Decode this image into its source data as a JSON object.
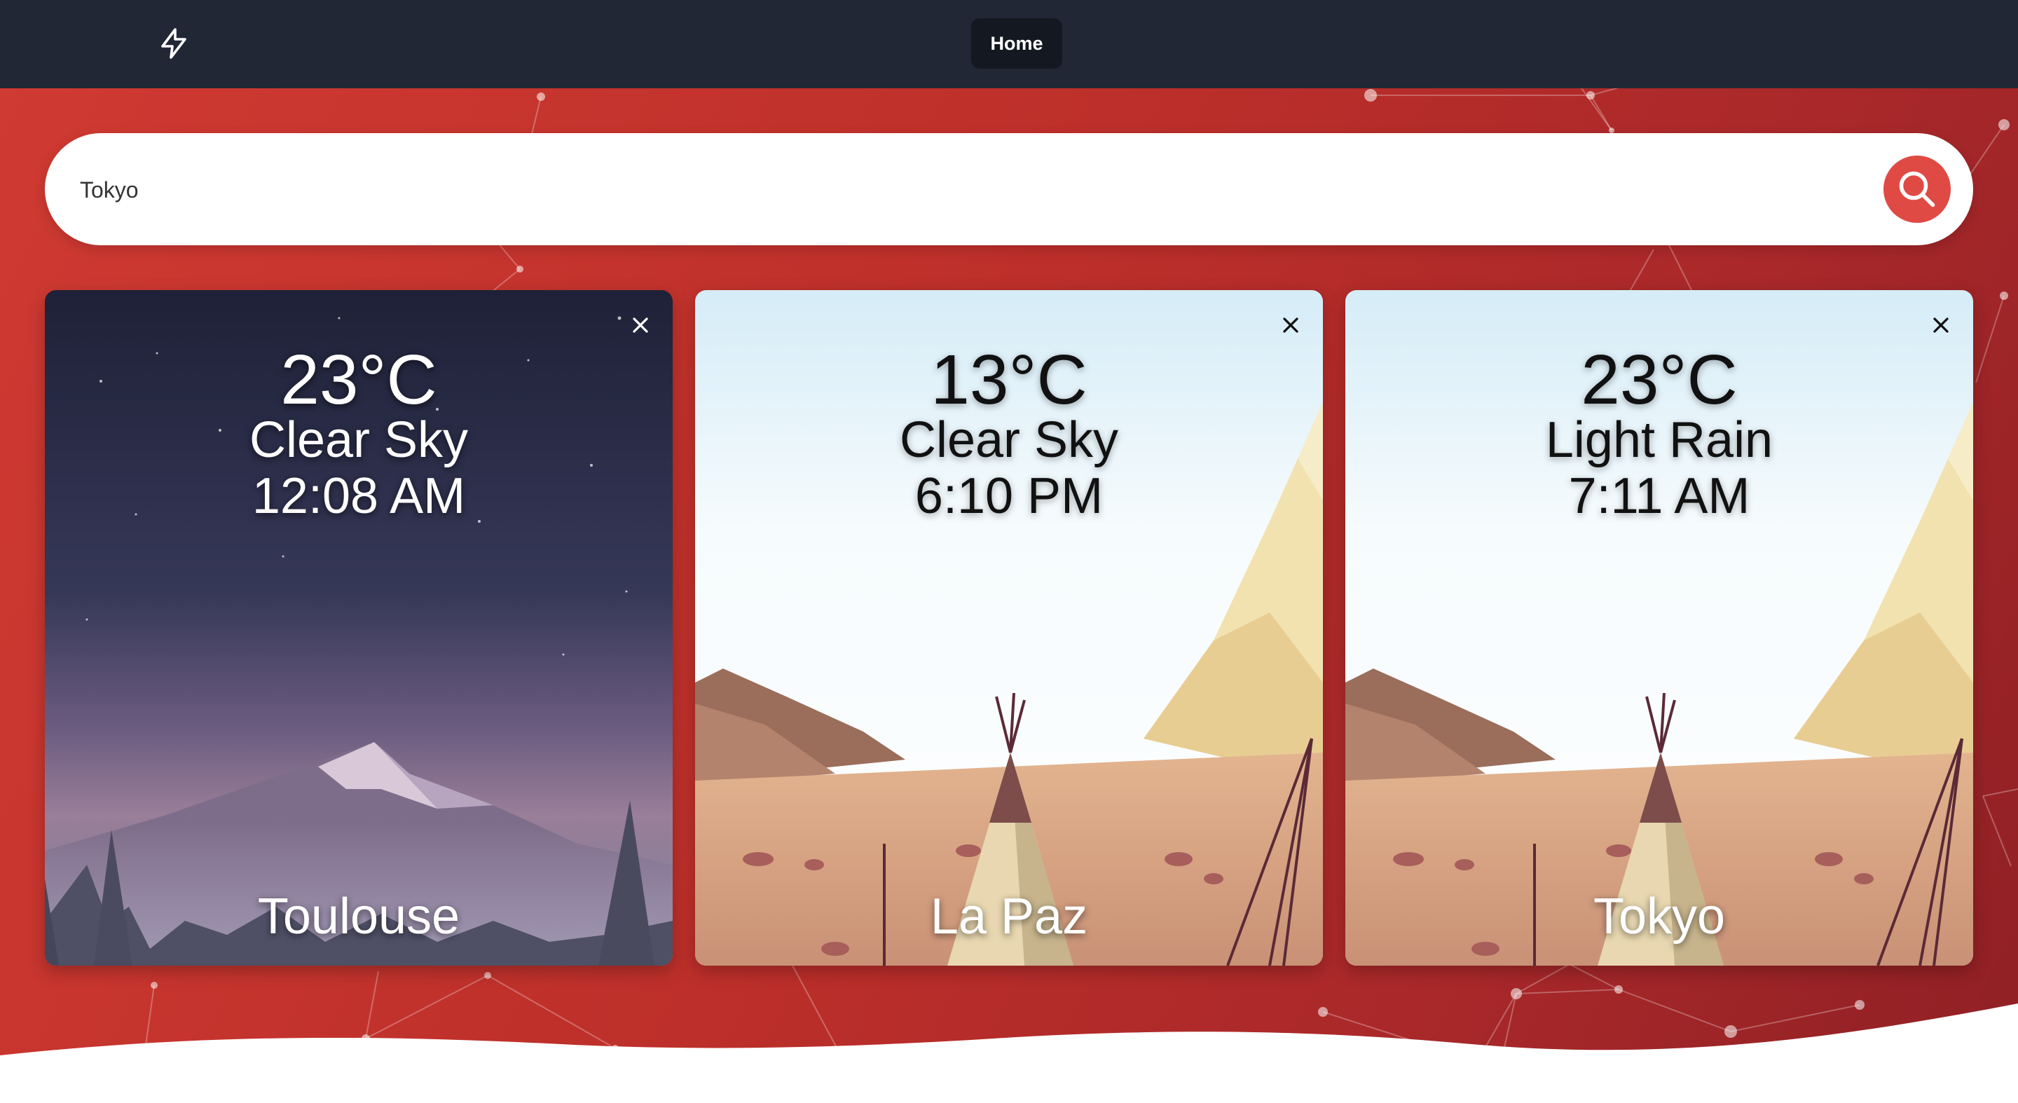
{
  "nav": {
    "logo_icon": "lightning-bolt-icon",
    "home_label": "Home"
  },
  "colors": {
    "navbar": "#222736",
    "hero_red": "#c0312b",
    "search_button": "#e04a45"
  },
  "search": {
    "value": "Tokyo",
    "button_icon": "search-icon"
  },
  "cards": [
    {
      "city": "Toulouse",
      "temperature": "23°C",
      "condition": "Clear Sky",
      "time": "12:08 AM",
      "background": "night-mountain-scene",
      "close_icon": "close-icon"
    },
    {
      "city": "La Paz",
      "temperature": "13°C",
      "condition": "Clear Sky",
      "time": "6:10 PM",
      "background": "day-desert-teepee-scene",
      "close_icon": "close-icon"
    },
    {
      "city": "Tokyo",
      "temperature": "23°C",
      "condition": "Light Rain",
      "time": "7:11 AM",
      "background": "day-desert-teepee-scene",
      "close_icon": "close-icon"
    }
  ]
}
